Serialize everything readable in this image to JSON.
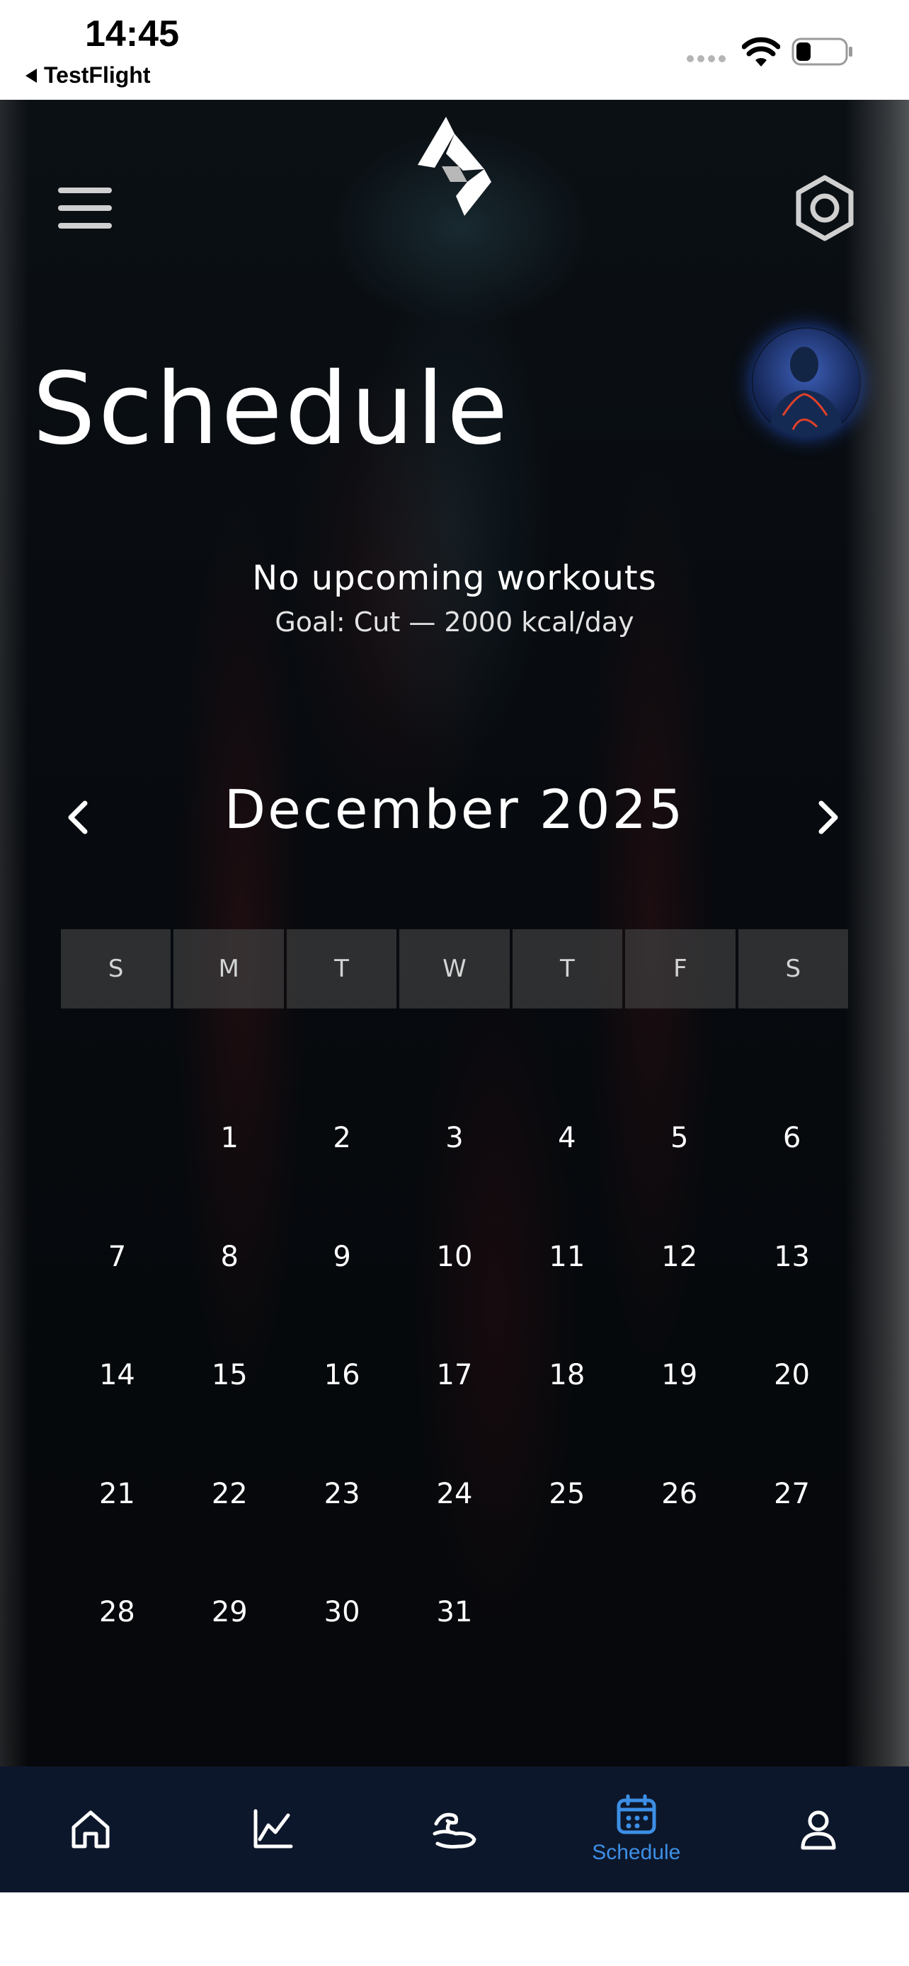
{
  "status_bar": {
    "time": "14:45",
    "back_label": "TestFlight"
  },
  "header": {
    "title": "Schedule"
  },
  "summary": {
    "message": "No upcoming workouts",
    "goal": "Goal: Cut — 2000 kcal/day"
  },
  "calendar": {
    "month_label": "December 2025",
    "weekdays": [
      "S",
      "M",
      "T",
      "W",
      "T",
      "F",
      "S"
    ],
    "days": [
      "",
      "1",
      "2",
      "3",
      "4",
      "5",
      "6",
      "7",
      "8",
      "9",
      "10",
      "11",
      "12",
      "13",
      "14",
      "15",
      "16",
      "17",
      "18",
      "19",
      "20",
      "21",
      "22",
      "23",
      "24",
      "25",
      "26",
      "27",
      "28",
      "29",
      "30",
      "31"
    ]
  },
  "tab_bar": {
    "items": [
      {
        "icon": "home-icon",
        "label": ""
      },
      {
        "icon": "chart-icon",
        "label": ""
      },
      {
        "icon": "muscle-icon",
        "label": ""
      },
      {
        "icon": "calendar-icon",
        "label": "Schedule"
      },
      {
        "icon": "profile-icon",
        "label": ""
      }
    ],
    "active_index": 3,
    "active_color": "#3c8fe6",
    "inactive_color": "#ffffff"
  },
  "colors": {
    "background": "#05080c",
    "text": "#ffffff",
    "tab_bar_background": "#0d172b",
    "accent": "#3c8fe6"
  }
}
